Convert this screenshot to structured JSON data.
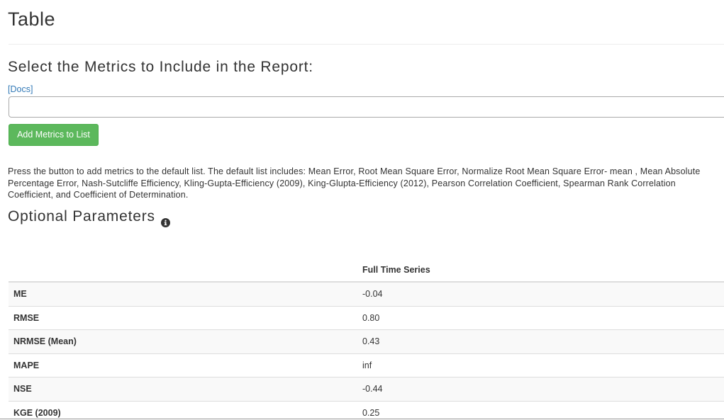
{
  "page": {
    "title": "Table"
  },
  "metrics_section": {
    "heading": "Select the Metrics to Include in the Report:",
    "docs_label": "[Docs]",
    "input_value": "",
    "add_button_label": "Add Metrics to List",
    "description": "Press the button to add metrics to the default list. The default list includes: Mean Error, Root Mean Square Error, Normalize Root Mean Square Error- mean , Mean Absolute Percentage Error, Nash-Sutcliffe Efficiency, Kling-Gupta-Efficiency (2009), King-Glupta-Efficiency (2012), Pearson Correlation Coefficient, Spearman Rank Correlation Coefficient, and Coefficient of Determination."
  },
  "optional_parameters": {
    "heading": "Optional Parameters",
    "info_icon": "info-circle-icon"
  },
  "results_table": {
    "columns": [
      "",
      "Full Time Series"
    ],
    "rows": [
      {
        "metric": "ME",
        "value": "-0.04"
      },
      {
        "metric": "RMSE",
        "value": "0.80"
      },
      {
        "metric": "NRMSE (Mean)",
        "value": "0.43"
      },
      {
        "metric": "MAPE",
        "value": "inf"
      },
      {
        "metric": "NSE",
        "value": "-0.44"
      },
      {
        "metric": "KGE (2009)",
        "value": "0.25"
      }
    ]
  },
  "colors": {
    "button_green": "#5cb85c",
    "link_blue": "#337ab7",
    "text": "#333333",
    "stripe": "#f9f9f9"
  }
}
